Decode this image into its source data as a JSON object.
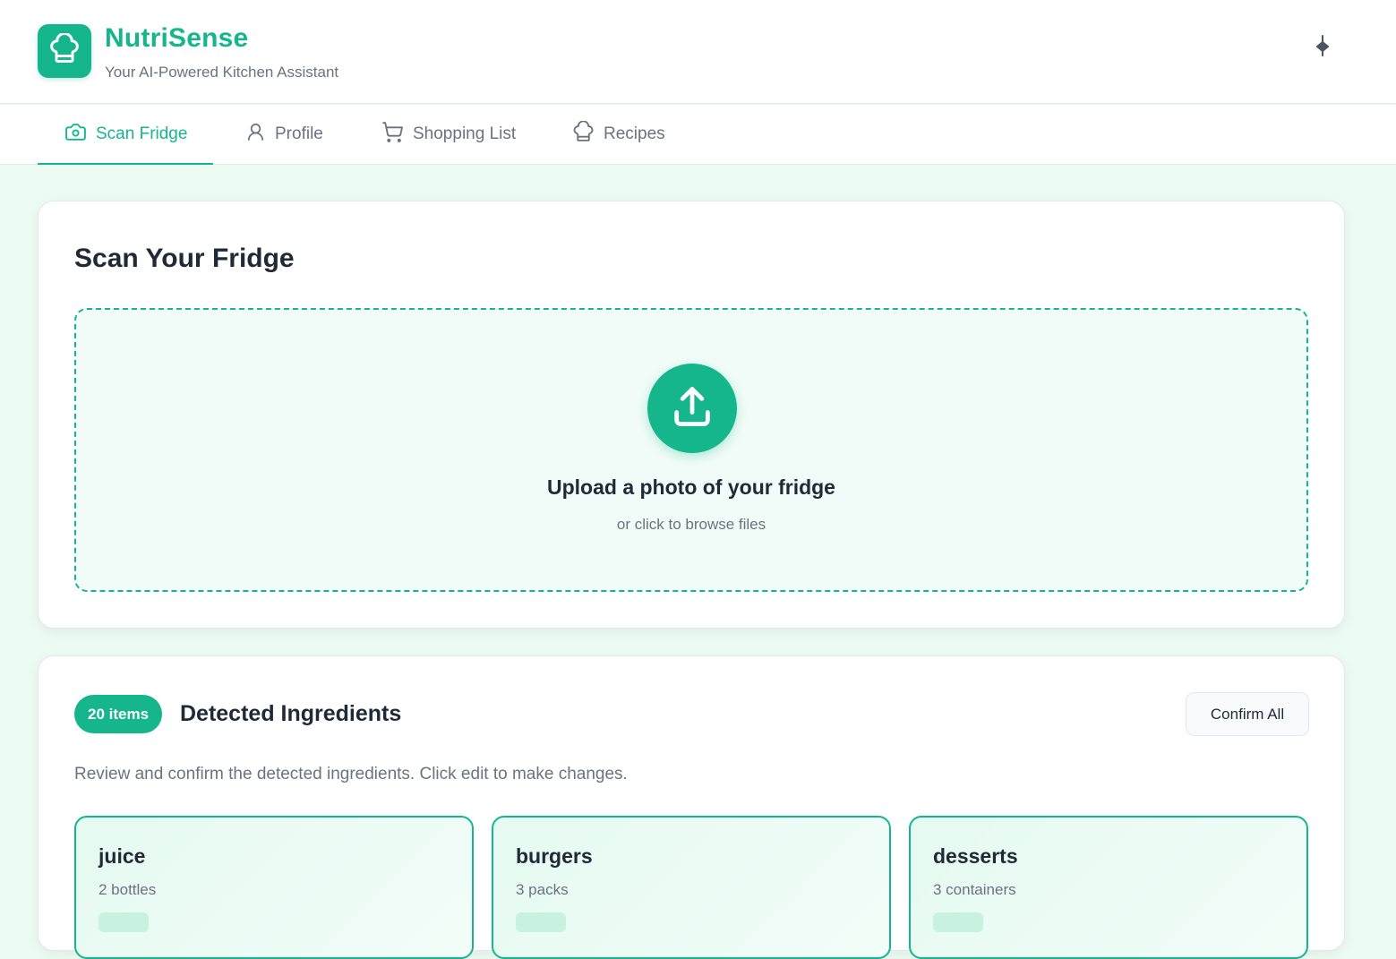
{
  "app": {
    "title": "NutriSense",
    "subtitle": "Your AI-Powered Kitchen Assistant",
    "logo_icon": "chef-hat-icon",
    "pin_icon": "pin-icon"
  },
  "colors": {
    "accent": "#16b68c",
    "background": "#ecfbf4",
    "text": "#1f2937",
    "muted": "#6b7280"
  },
  "tabs": [
    {
      "label": "Scan Fridge",
      "icon": "camera-icon",
      "active": true
    },
    {
      "label": "Profile",
      "icon": "user-icon",
      "active": false
    },
    {
      "label": "Shopping List",
      "icon": "cart-icon",
      "active": false
    },
    {
      "label": "Recipes",
      "icon": "chef-hat-icon",
      "active": false
    }
  ],
  "scan": {
    "title": "Scan Your Fridge",
    "upload_icon": "upload-icon",
    "upload_title": "Upload a photo of your fridge",
    "upload_sub": "or click to browse files"
  },
  "ingredients": {
    "count_label": "20 items",
    "title": "Detected Ingredients",
    "confirm_label": "Confirm All",
    "description": "Review and confirm the detected ingredients. Click edit to make changes.",
    "items": [
      {
        "name": "juice",
        "quantity": "2 bottles"
      },
      {
        "name": "burgers",
        "quantity": "3 packs"
      },
      {
        "name": "desserts",
        "quantity": "3 containers"
      }
    ]
  }
}
